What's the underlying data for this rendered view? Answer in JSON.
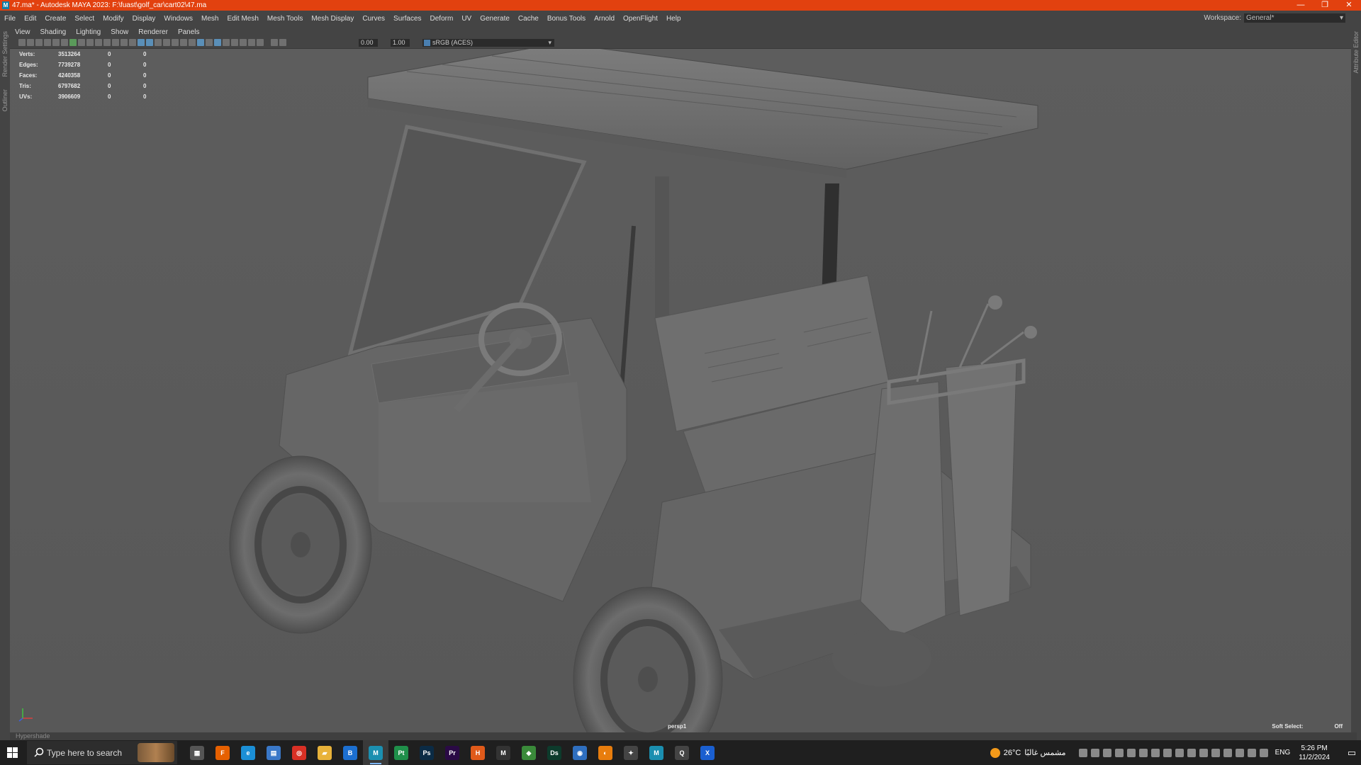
{
  "window": {
    "title": "47.ma* - Autodesk MAYA 2023: F:\\fuast\\golf_car\\cart02\\47.ma",
    "logo": "M",
    "controls": [
      "—",
      "❐",
      "✕"
    ]
  },
  "menubar": {
    "items": [
      "File",
      "Edit",
      "Create",
      "Select",
      "Modify",
      "Display",
      "Windows",
      "Mesh",
      "Edit Mesh",
      "Mesh Tools",
      "Mesh Display",
      "Curves",
      "Surfaces",
      "Deform",
      "UV",
      "Generate",
      "Cache",
      "Bonus Tools",
      "Arnold",
      "OpenFlight",
      "Help"
    ],
    "workspace_label": "Workspace:",
    "workspace_value": "General*"
  },
  "side_tabs": {
    "left": [
      "Render Settings",
      "Outliner"
    ],
    "right": [
      "Attribute Editor"
    ]
  },
  "panel_menu": [
    "View",
    "Shading",
    "Lighting",
    "Show",
    "Renderer",
    "Panels"
  ],
  "toolbar": {
    "exposure": "0.00",
    "gamma": "1.00",
    "color_space": "sRGB (ACES)"
  },
  "hud": {
    "rows": [
      {
        "label": "Verts:",
        "value": "3513264",
        "c1": "0",
        "c2": "0"
      },
      {
        "label": "Edges:",
        "value": "7739278",
        "c1": "0",
        "c2": "0"
      },
      {
        "label": "Faces:",
        "value": "4240358",
        "c1": "0",
        "c2": "0"
      },
      {
        "label": "Tris:",
        "value": "6797682",
        "c1": "0",
        "c2": "0"
      },
      {
        "label": "UVs:",
        "value": "3906609",
        "c1": "0",
        "c2": "0"
      }
    ],
    "camera": "persp1",
    "soft_select_label": "Soft Select:",
    "soft_select_value": "Off"
  },
  "statusbar": {
    "text": "Hypershade"
  },
  "taskbar": {
    "search_placeholder": "Type here to search",
    "apps": [
      {
        "name": "task-view",
        "glyph": "▦",
        "color": "#555"
      },
      {
        "name": "firefox",
        "glyph": "F",
        "color": "#e66000"
      },
      {
        "name": "edge",
        "glyph": "e",
        "color": "#1b8fd6"
      },
      {
        "name": "store",
        "glyph": "▤",
        "color": "#3a78c8"
      },
      {
        "name": "chrome",
        "glyph": "◎",
        "color": "#d93025"
      },
      {
        "name": "explorer",
        "glyph": "▰",
        "color": "#e8b23a"
      },
      {
        "name": "app-blue",
        "glyph": "B",
        "color": "#1c6fd0"
      },
      {
        "name": "maya",
        "glyph": "M",
        "color": "#1b8fb0"
      },
      {
        "name": "pycharm",
        "glyph": "Pt",
        "color": "#1f8f4a"
      },
      {
        "name": "photoshop",
        "glyph": "Ps",
        "color": "#0b2b45"
      },
      {
        "name": "premiere",
        "glyph": "Pr",
        "color": "#2a0a45"
      },
      {
        "name": "houdini",
        "glyph": "H",
        "color": "#e05a1a"
      },
      {
        "name": "marmoset",
        "glyph": "M",
        "color": "#333"
      },
      {
        "name": "maps",
        "glyph": "◆",
        "color": "#3a8a3a"
      },
      {
        "name": "substance-designer",
        "glyph": "Ds",
        "color": "#0d3b2c"
      },
      {
        "name": "app-circle",
        "glyph": "◉",
        "color": "#2f6fbf"
      },
      {
        "name": "blender",
        "glyph": "◐",
        "color": "#e87d0d"
      },
      {
        "name": "app-tool",
        "glyph": "✦",
        "color": "#444"
      },
      {
        "name": "maya-2",
        "glyph": "M",
        "color": "#1b8fb0"
      },
      {
        "name": "app-q",
        "glyph": "Q",
        "color": "#444"
      },
      {
        "name": "app-x",
        "glyph": "X",
        "color": "#1a5fd0"
      }
    ],
    "weather_temp": "26°C",
    "weather_text": "مشمس غالبًا",
    "language": "ENG",
    "time": "5:26 PM",
    "date": "11/2/2024"
  }
}
